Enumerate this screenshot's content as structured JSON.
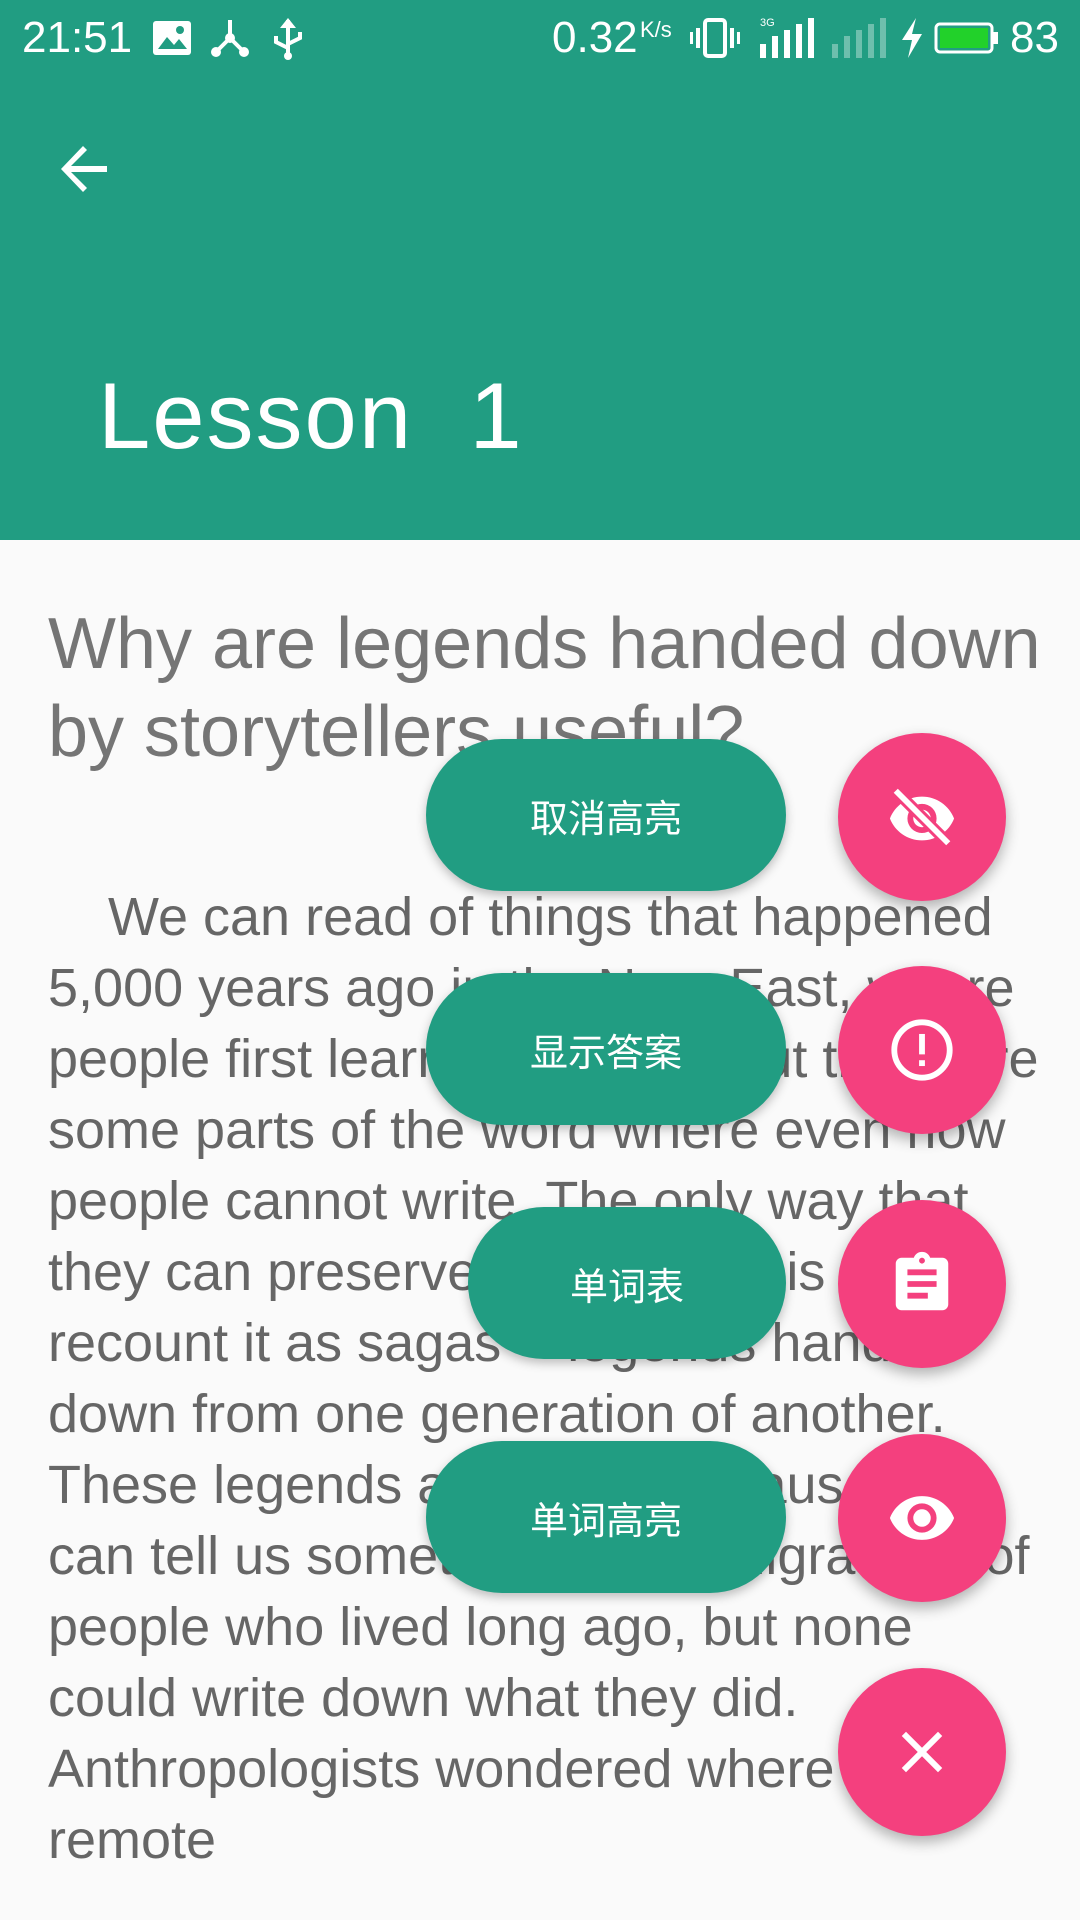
{
  "status_bar": {
    "time": "21:51",
    "net_speed": "0.32",
    "net_speed_unit": "K/s",
    "battery_percent": "83",
    "icons": [
      "image-icon",
      "share-hub-icon",
      "usb-icon",
      "vibrate-icon",
      "signal-3g-icon",
      "signal-empty-icon",
      "charging-icon",
      "battery-icon"
    ]
  },
  "app_bar": {
    "back_icon": "arrow-back-icon",
    "title": "Lesson  1"
  },
  "content": {
    "question": "Why are legends handed down by storytellers useful?",
    "passage": "We can read of things that happened 5,000 years ago in the Near East, where people first learned to write. But there are some parts of the word where even now people cannot write. The only way that they can preserve their history is to recount it as sagas -- legends handed down from one generation of another. These legends are useful because they can tell us something about migrations of people who lived long ago, but none could write down what they did. Anthropologists wondered where the remote"
  },
  "fab_menu": {
    "items": [
      {
        "label": "取消高亮",
        "icon": "eye-off-icon"
      },
      {
        "label": "显示答案",
        "icon": "alert-circle-icon"
      },
      {
        "label": "单词表",
        "icon": "clipboard-icon"
      },
      {
        "label": "单词高亮",
        "icon": "eye-icon"
      }
    ],
    "close_icon": "close-icon"
  },
  "colors": {
    "primary": "#219d82",
    "accent": "#f4407e",
    "background": "#fafafa",
    "text_secondary": "#757575"
  }
}
